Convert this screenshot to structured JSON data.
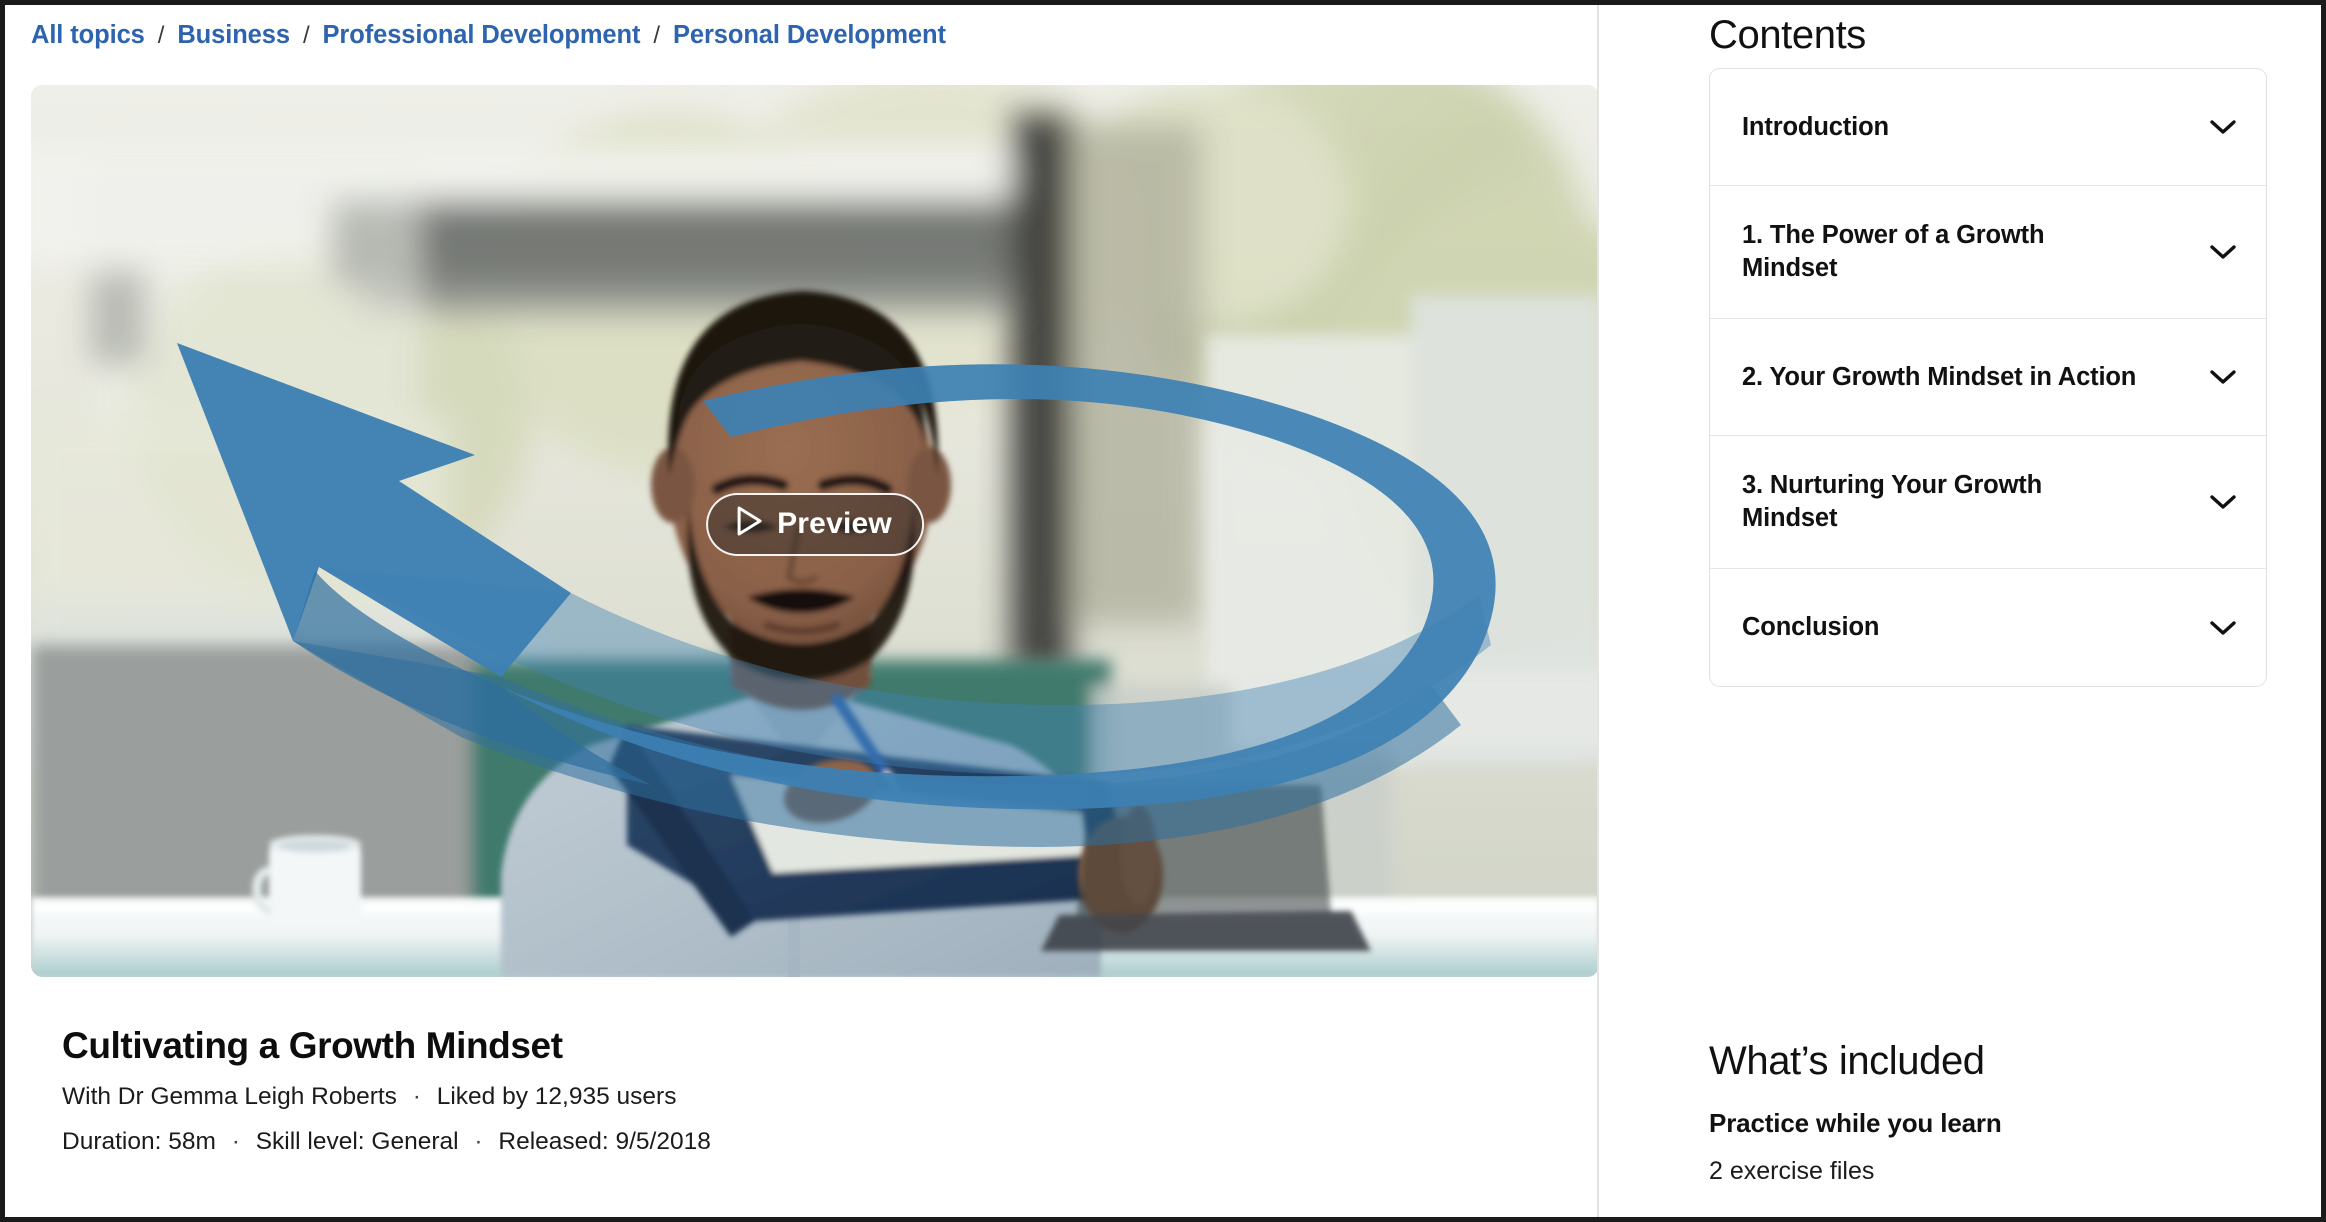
{
  "breadcrumb": {
    "separator": "/",
    "items": [
      {
        "label": "All topics"
      },
      {
        "label": "Business"
      },
      {
        "label": "Professional Development"
      },
      {
        "label": "Personal Development"
      }
    ]
  },
  "video": {
    "preview_label": "Preview",
    "play_icon": "play-triangle-icon",
    "alt_description": "Man in light blue shirt writing in a dark blue notebook at a desk with a white mug, large blue upward arrow swoosh graphic overlay"
  },
  "course": {
    "title": "Cultivating a Growth Mindset",
    "author_line": "With Dr Gemma Leigh Roberts",
    "likes_line": "Liked by 12,935 users",
    "duration_label": "Duration: 58m",
    "skill_label": "Skill level: General",
    "released_label": "Released: 9/5/2018",
    "dot": "·"
  },
  "contents": {
    "heading": "Contents",
    "chevron_icon": "chevron-down-icon",
    "items": [
      {
        "label": "Introduction",
        "twoline": false
      },
      {
        "label": "1. The Power of a Growth Mindset",
        "twoline": true
      },
      {
        "label": "2. Your Growth Mindset in Action",
        "twoline": false
      },
      {
        "label": "3. Nurturing Your Growth Mindset",
        "twoline": true
      },
      {
        "label": "Conclusion",
        "twoline": false
      }
    ]
  },
  "whats_included": {
    "heading": "What’s included",
    "subheading": "Practice while you learn",
    "detail": "2 exercise files"
  },
  "colors": {
    "link_blue": "#2e63ad",
    "arrow_blue": "#3d80b3",
    "text_dark": "#111111",
    "border_gray": "#e0e0e0",
    "page_frame": "#1a1a1a"
  }
}
